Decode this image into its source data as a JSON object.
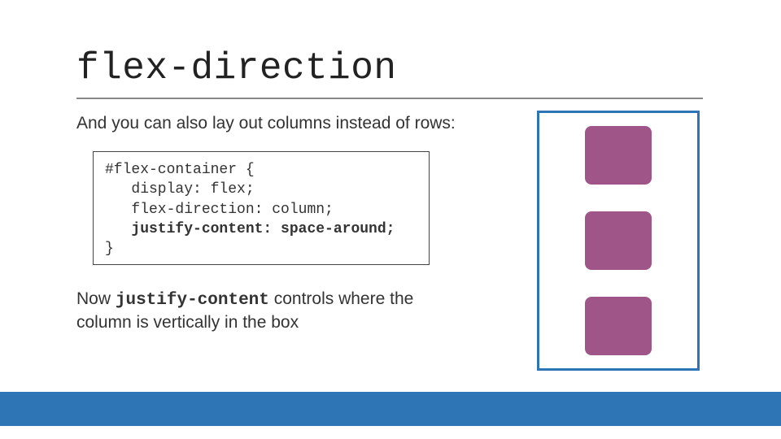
{
  "title": "flex-direction",
  "intro": "And you can also lay out columns instead of rows:",
  "code": {
    "l1": "#flex-container {",
    "l2": "   display: flex;",
    "l3": "   flex-direction: column;",
    "l4": "   justify-content: space-around;",
    "l5": "}"
  },
  "para2_a": "Now ",
  "para2_b": "justify-content",
  "para2_c": " controls where the column is vertically in the box",
  "colors": {
    "accent": "#2e75b6",
    "box": "#a05588"
  }
}
